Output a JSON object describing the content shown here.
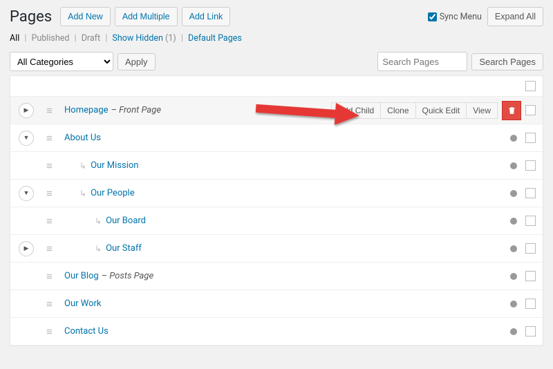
{
  "header": {
    "title": "Pages",
    "addNew": "Add New",
    "addMultiple": "Add Multiple",
    "addLink": "Add Link",
    "syncMenu": "Sync Menu",
    "expandAll": "Expand All"
  },
  "filters": {
    "all": "All",
    "published": "Published",
    "draft": "Draft",
    "showHidden": "Show Hidden",
    "hiddenCount": "(1)",
    "defaultPages": "Default Pages"
  },
  "controls": {
    "categorySelect": "All Categories",
    "apply": "Apply",
    "searchPlaceholder": "Search Pages",
    "searchButton": "Search Pages"
  },
  "rowActions": {
    "addChild": "Add Child",
    "clone": "Clone",
    "quickEdit": "Quick Edit",
    "view": "View"
  },
  "pages": [
    {
      "title": "Homepage",
      "suffix": "– Front Page",
      "indent": 0,
      "expand": "right",
      "highlight": true,
      "showActions": true
    },
    {
      "title": "About Us",
      "indent": 0,
      "expand": "down"
    },
    {
      "title": "Our Mission",
      "indent": 1,
      "childArrow": true
    },
    {
      "title": "Our People",
      "indent": 1,
      "expand": "down",
      "childArrow": true
    },
    {
      "title": "Our Board",
      "indent": 2,
      "childArrow": true
    },
    {
      "title": "Our Staff",
      "indent": 2,
      "expand": "right",
      "childArrow": true
    },
    {
      "title": "Our Blog",
      "suffix": "– Posts Page",
      "indent": 0
    },
    {
      "title": "Our Work",
      "indent": 0
    },
    {
      "title": "Contact Us",
      "indent": 0
    }
  ]
}
